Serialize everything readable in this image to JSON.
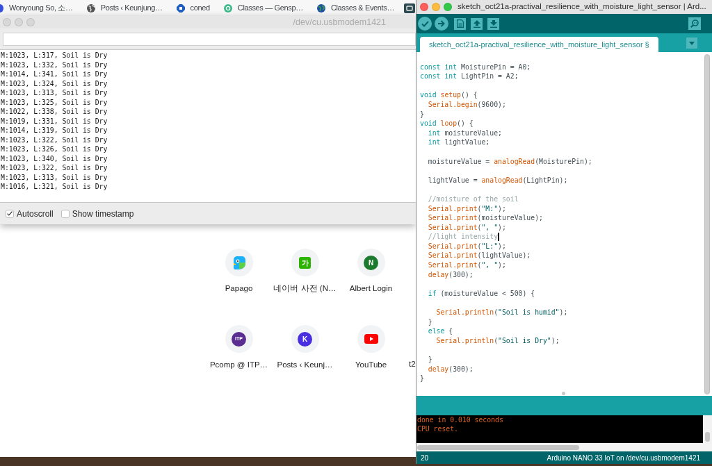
{
  "browser": {
    "bookmarks": [
      {
        "label": "Wonyoung So, 소…"
      },
      {
        "label": "Posts ‹ Keunjung…"
      },
      {
        "label": "coned"
      },
      {
        "label": "Classes — Gensp…"
      },
      {
        "label": "Classes & Events…"
      }
    ],
    "shortcuts": [
      {
        "label": "Papago"
      },
      {
        "label": "네이버 사전 (N…",
        "icon_text": "가"
      },
      {
        "label": "Albert Login",
        "icon_text": "N"
      },
      {
        "label": "Pcomp @ ITP…",
        "icon_text": "ITP"
      },
      {
        "label": "Posts ‹ Keunj…",
        "icon_text": "K"
      },
      {
        "label": "YouTube"
      }
    ],
    "cut_off_shortcut_label": "t2"
  },
  "serial_monitor": {
    "active": false,
    "title": "/dev/cu.usbmodem1421",
    "output": [
      "M:1023, L:317, Soil is Dry",
      "M:1023, L:332, Soil is Dry",
      "M:1014, L:341, Soil is Dry",
      "M:1023, L:324, Soil is Dry",
      "M:1023, L:313, Soil is Dry",
      "M:1023, L:325, Soil is Dry",
      "M:1022, L:338, Soil is Dry",
      "M:1019, L:331, Soil is Dry",
      "M:1014, L:319, Soil is Dry",
      "M:1023, L:322, Soil is Dry",
      "M:1023, L:326, Soil is Dry",
      "M:1023, L:340, Soil is Dry",
      "M:1023, L:322, Soil is Dry",
      "M:1023, L:313, Soil is Dry",
      "M:1016, L:321, Soil is Dry"
    ],
    "options": [
      {
        "label": "Autoscroll",
        "checked": true
      },
      {
        "label": "Show timestamp",
        "checked": false
      }
    ]
  },
  "ide": {
    "active": true,
    "title": "sketch_oct21a-practival_resilience_with_moisture_light_sensor | Ard...",
    "tabs": [
      {
        "label": "sketch_oct21a-practival_resilience_with_moisture_light_sensor §",
        "selected": true
      }
    ],
    "code": [
      {
        "kind": "blank"
      },
      {
        "kind": "code",
        "tokens": [
          {
            "kind": "keyword",
            "text": "const int"
          },
          {
            "kind": "plain",
            "text": " MoisturePin = A0;"
          }
        ]
      },
      {
        "kind": "code",
        "tokens": [
          {
            "kind": "keyword",
            "text": "const int"
          },
          {
            "kind": "plain",
            "text": " LightPin = A2;"
          }
        ]
      },
      {
        "kind": "blank"
      },
      {
        "kind": "code",
        "tokens": [
          {
            "kind": "keyword",
            "text": "void"
          },
          {
            "kind": "function",
            "text": " setup"
          },
          {
            "kind": "plain",
            "text": "() {"
          }
        ],
        "children": [
          {
            "kind": "code",
            "tokens": [
              {
                "kind": "function",
                "text": "Serial.begin"
              },
              {
                "kind": "plain",
                "text": "(9600);"
              }
            ]
          }
        ]
      },
      {
        "kind": "code",
        "tokens": [
          {
            "kind": "plain",
            "text": "}"
          }
        ]
      },
      {
        "kind": "code",
        "tokens": [
          {
            "kind": "keyword",
            "text": "void"
          },
          {
            "kind": "function",
            "text": " loop"
          },
          {
            "kind": "plain",
            "text": "() {"
          }
        ],
        "children": [
          {
            "kind": "code",
            "tokens": [
              {
                "kind": "keyword",
                "text": "int"
              },
              {
                "kind": "plain",
                "text": " moistureValue;"
              }
            ]
          },
          {
            "kind": "code",
            "tokens": [
              {
                "kind": "keyword",
                "text": "int"
              },
              {
                "kind": "plain",
                "text": " lightValue;"
              }
            ]
          },
          {
            "kind": "blank"
          },
          {
            "kind": "code",
            "tokens": [
              {
                "kind": "plain",
                "text": "moistureValue = "
              },
              {
                "kind": "function",
                "text": "analogRead"
              },
              {
                "kind": "plain",
                "text": "(MoisturePin);"
              }
            ]
          },
          {
            "kind": "blank"
          },
          {
            "kind": "code",
            "tokens": [
              {
                "kind": "plain",
                "text": "lightValue = "
              },
              {
                "kind": "function",
                "text": "analogRead"
              },
              {
                "kind": "plain",
                "text": "(LightPin);"
              }
            ]
          },
          {
            "kind": "blank"
          },
          {
            "kind": "code",
            "tokens": [
              {
                "kind": "comment",
                "text": "//moisture of the soil"
              }
            ]
          },
          {
            "kind": "code",
            "tokens": [
              {
                "kind": "function",
                "text": "Serial.print"
              },
              {
                "kind": "plain",
                "text": "("
              },
              {
                "kind": "string",
                "text": "\"M:\""
              },
              {
                "kind": "plain",
                "text": ");"
              }
            ]
          },
          {
            "kind": "code",
            "tokens": [
              {
                "kind": "function",
                "text": "Serial.print"
              },
              {
                "kind": "plain",
                "text": "(moistureValue);"
              }
            ]
          },
          {
            "kind": "code",
            "tokens": [
              {
                "kind": "function",
                "text": "Serial.print"
              },
              {
                "kind": "plain",
                "text": "("
              },
              {
                "kind": "string",
                "text": "\", \""
              },
              {
                "kind": "plain",
                "text": ");"
              }
            ]
          },
          {
            "kind": "code",
            "tokens": [
              {
                "kind": "comment",
                "text": "//light intensity"
              },
              {
                "kind": "caret"
              }
            ]
          },
          {
            "kind": "code",
            "tokens": [
              {
                "kind": "function",
                "text": "Serial.print"
              },
              {
                "kind": "plain",
                "text": "("
              },
              {
                "kind": "string",
                "text": "\"L:\""
              },
              {
                "kind": "plain",
                "text": ");"
              }
            ]
          },
          {
            "kind": "code",
            "tokens": [
              {
                "kind": "function",
                "text": "Serial.print"
              },
              {
                "kind": "plain",
                "text": "(lightValue);"
              }
            ]
          },
          {
            "kind": "code",
            "tokens": [
              {
                "kind": "function",
                "text": "Serial.print"
              },
              {
                "kind": "plain",
                "text": "("
              },
              {
                "kind": "string",
                "text": "\", \""
              },
              {
                "kind": "plain",
                "text": ");"
              }
            ]
          },
          {
            "kind": "code",
            "tokens": [
              {
                "kind": "function",
                "text": "delay"
              },
              {
                "kind": "plain",
                "text": "(300);"
              }
            ]
          },
          {
            "kind": "blank"
          },
          {
            "kind": "code",
            "tokens": [
              {
                "kind": "keyword",
                "text": "if"
              },
              {
                "kind": "plain",
                "text": " (moistureValue < 500) {"
              }
            ],
            "children": [
              {
                "kind": "blank"
              },
              {
                "kind": "code",
                "tokens": [
                  {
                    "kind": "function",
                    "text": "Serial.println"
                  },
                  {
                    "kind": "plain",
                    "text": "("
                  },
                  {
                    "kind": "string",
                    "text": "\"Soil is humid\""
                  },
                  {
                    "kind": "plain",
                    "text": ");"
                  }
                ]
              }
            ]
          },
          {
            "kind": "code",
            "tokens": [
              {
                "kind": "plain",
                "text": "}"
              }
            ]
          },
          {
            "kind": "code",
            "tokens": [
              {
                "kind": "keyword",
                "text": "else"
              },
              {
                "kind": "plain",
                "text": " {"
              }
            ],
            "children": [
              {
                "kind": "code",
                "tokens": [
                  {
                    "kind": "function",
                    "text": "Serial.println"
                  },
                  {
                    "kind": "plain",
                    "text": "("
                  },
                  {
                    "kind": "string",
                    "text": "\"Soil is Dry\""
                  },
                  {
                    "kind": "plain",
                    "text": ");"
                  }
                ]
              },
              {
                "kind": "blank"
              }
            ]
          },
          {
            "kind": "code",
            "tokens": [
              {
                "kind": "plain",
                "text": "}"
              }
            ]
          },
          {
            "kind": "code",
            "tokens": [
              {
                "kind": "function",
                "text": "delay"
              },
              {
                "kind": "plain",
                "text": "(300);"
              }
            ]
          }
        ]
      },
      {
        "kind": "code",
        "tokens": [
          {
            "kind": "plain",
            "text": "}"
          }
        ]
      }
    ],
    "console": [
      "done in 0.010 seconds",
      "CPU reset."
    ],
    "status_bar": {
      "line": "20",
      "board": "Arduino NANO 33 IoT on /dev/cu.usbmodem1421"
    }
  }
}
